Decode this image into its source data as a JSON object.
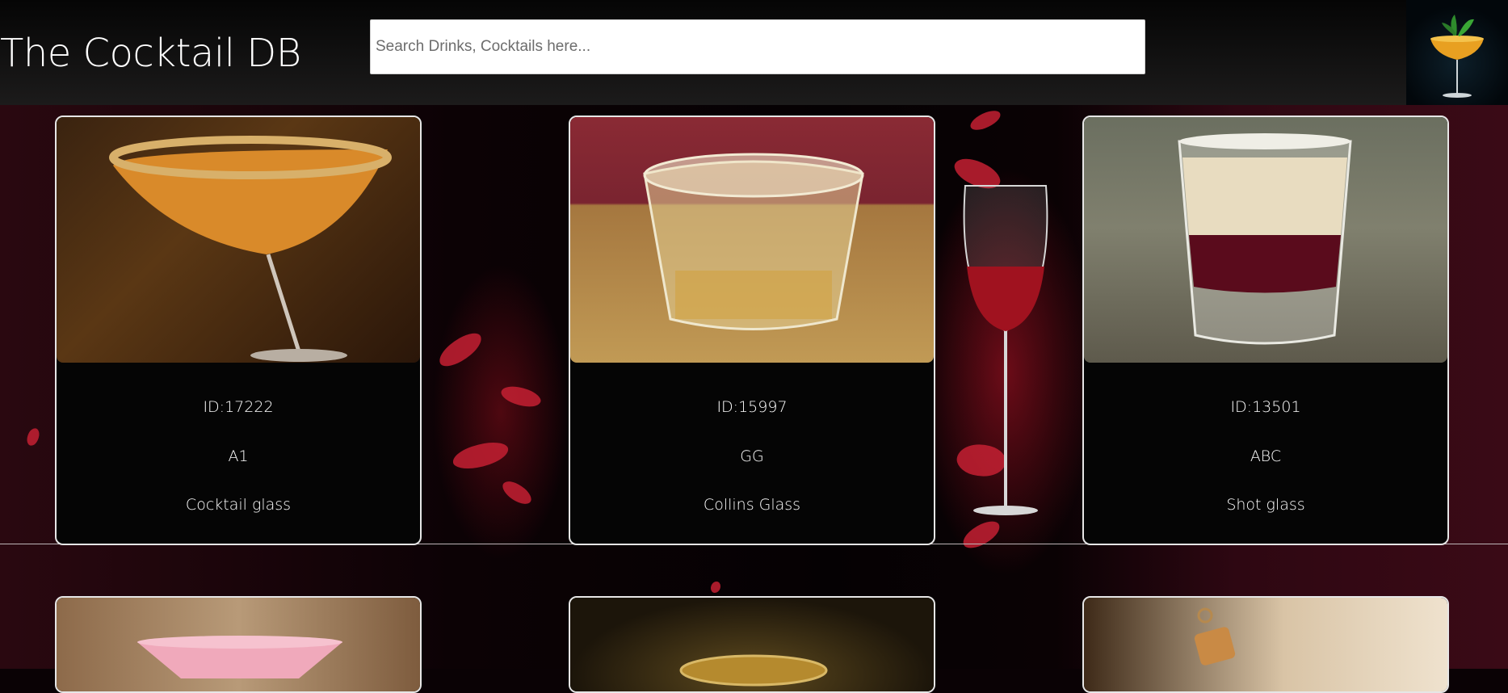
{
  "header": {
    "title": "The Cocktail DB",
    "search_placeholder": "Search Drinks, Cocktails here..."
  },
  "drinks": [
    {
      "id_label": "ID:17222",
      "name": "A1",
      "glass": "Cocktail glass"
    },
    {
      "id_label": "ID:15997",
      "name": "GG",
      "glass": "Collins Glass"
    },
    {
      "id_label": "ID:13501",
      "name": "ABC",
      "glass": "Shot glass"
    }
  ],
  "icons": {
    "logo": "cocktail-logo-icon"
  },
  "colors": {
    "header_bg": "#141414",
    "card_bg": "#050505",
    "card_border": "#e6e6e6",
    "accent_red": "#c42033"
  }
}
